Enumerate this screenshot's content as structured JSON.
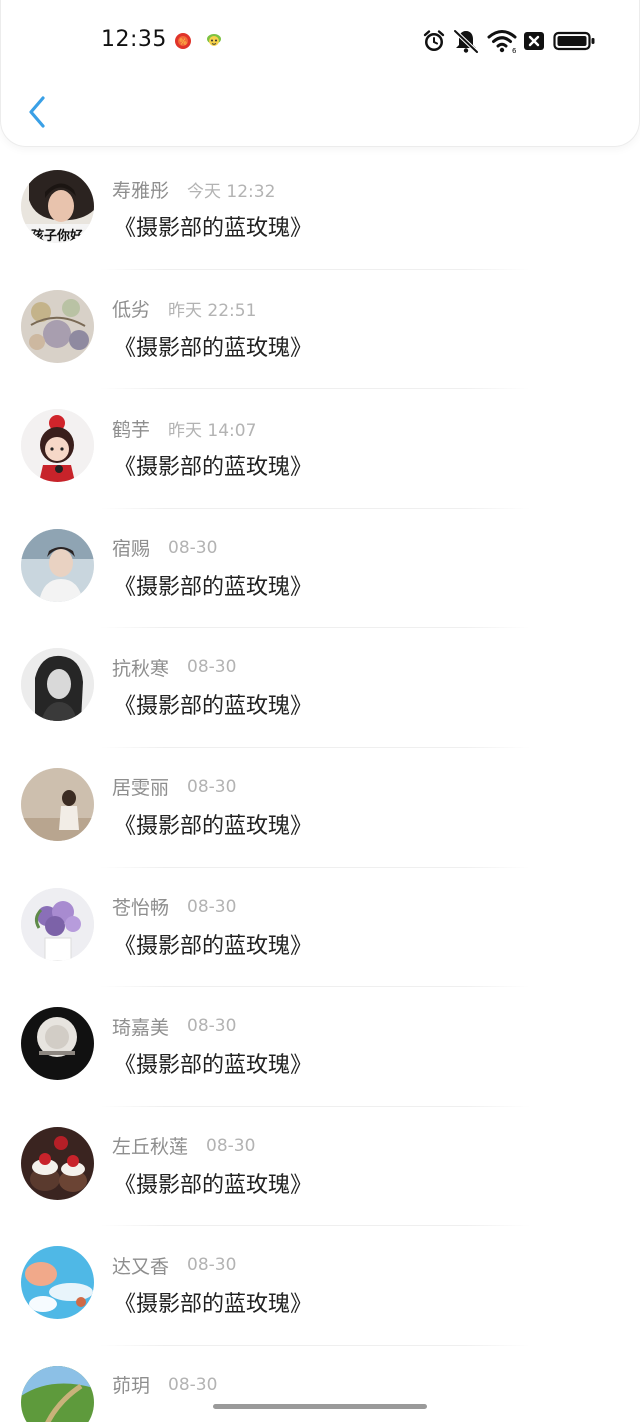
{
  "status_bar": {
    "time": "12:35",
    "notification_icons": [
      "red-app-notification-icon",
      "green-app-notification-icon"
    ],
    "system_icons": [
      "alarm-icon",
      "muted-bell-icon",
      "wifi-icon",
      "no-sim-icon",
      "battery-icon"
    ]
  },
  "nav": {
    "back_icon": "chevron-left-icon",
    "accent_color": "#3aa0e6"
  },
  "list": {
    "items": [
      {
        "name": "寿雅彤",
        "time": "今天 12:32",
        "title": "《摄影部的蓝玫瑰》"
      },
      {
        "name": "低劣",
        "time": "昨天 22:51",
        "title": "《摄影部的蓝玫瑰》"
      },
      {
        "name": "鹤芋",
        "time": "昨天 14:07",
        "title": "《摄影部的蓝玫瑰》"
      },
      {
        "name": "宿赐",
        "time": "08-30",
        "title": "《摄影部的蓝玫瑰》"
      },
      {
        "name": "抗秋寒",
        "time": "08-30",
        "title": "《摄影部的蓝玫瑰》"
      },
      {
        "name": "居雯丽",
        "time": "08-30",
        "title": "《摄影部的蓝玫瑰》"
      },
      {
        "name": "苍怡畅",
        "time": "08-30",
        "title": "《摄影部的蓝玫瑰》"
      },
      {
        "name": "琦嘉美",
        "time": "08-30",
        "title": "《摄影部的蓝玫瑰》"
      },
      {
        "name": "左丘秋莲",
        "time": "08-30",
        "title": "《摄影部的蓝玫瑰》"
      },
      {
        "name": "达又香",
        "time": "08-30",
        "title": "《摄影部的蓝玫瑰》"
      },
      {
        "name": "茆玥",
        "time": "08-30",
        "title": ""
      }
    ]
  },
  "avatar_text": {
    "first": "孩子你好"
  }
}
